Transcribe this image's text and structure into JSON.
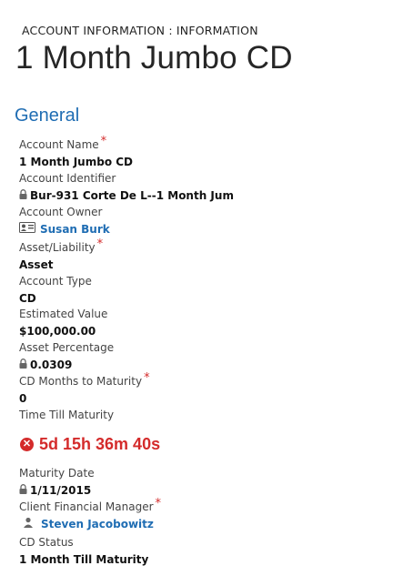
{
  "header": {
    "breadcrumb": "ACCOUNT INFORMATION : INFORMATION",
    "title": "1 Month Jumbo CD"
  },
  "section": {
    "title": "General"
  },
  "fields": [
    {
      "label": "Account Name",
      "required": true,
      "value": "1 Month Jumbo CD"
    },
    {
      "label": "Account Identifier",
      "required": false,
      "value": "Bur-931 Corte De L--1 Month Jum",
      "icon": "lock-icon"
    },
    {
      "label": "Account Owner",
      "required": false,
      "value": "Susan Burk",
      "icon": "user-card-icon"
    },
    {
      "label": "Asset/Liability",
      "required": true,
      "value": "Asset"
    },
    {
      "label": "Account Type",
      "required": false,
      "value": "CD"
    },
    {
      "label": "Estimated Value",
      "required": false,
      "value": "$100,000.00"
    },
    {
      "label": "Asset Percentage",
      "required": false,
      "value": "0.0309",
      "icon": "lock-icon"
    },
    {
      "label": "CD Months to Maturity",
      "required": true,
      "value": "0"
    },
    {
      "label": "Time Till Maturity",
      "required": false,
      "value": ""
    },
    {
      "label": "Maturity Date",
      "required": false,
      "value": "1/11/2015",
      "icon": "lock-icon"
    },
    {
      "label": "Client Financial Manager",
      "required": true,
      "value": "Steven Jacobowitz",
      "icon": "person-icon"
    },
    {
      "label": "CD Status",
      "required": false,
      "value": "1 Month Till Maturity"
    }
  ],
  "timer": {
    "value": "5d 15h 36m 40s",
    "status": "expired",
    "color": "#d42b2b"
  },
  "colors": {
    "accent": "#1f6db3",
    "required": "#d42b2b"
  }
}
